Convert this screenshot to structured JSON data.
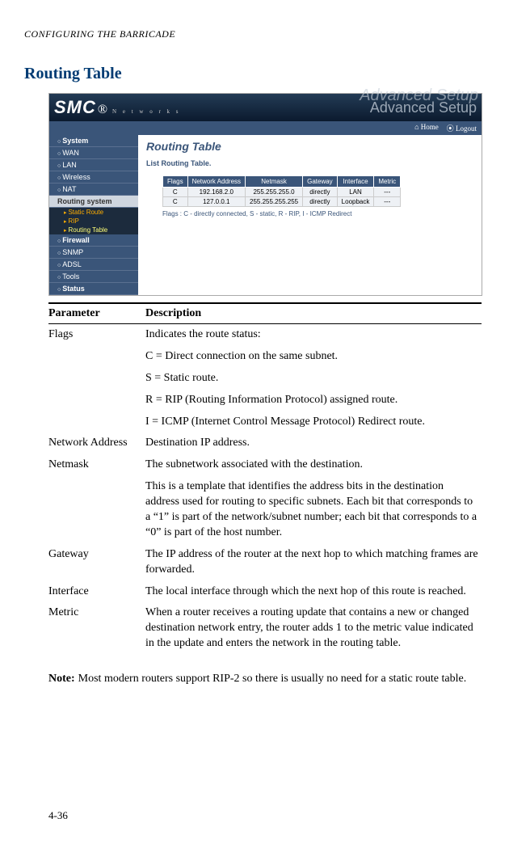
{
  "header": {
    "running": "CONFIGURING THE BARRICADE"
  },
  "section": {
    "title": "Routing Table"
  },
  "router_ui": {
    "logo": {
      "brand": "SMC",
      "reg": "®",
      "subtitle": "N e t w o r k s"
    },
    "titlebar": {
      "ghost": "Advanced Setup",
      "main": "Advanced Setup"
    },
    "toplinks": {
      "home": "Home",
      "logout": "Logout"
    },
    "sidebar": {
      "items": [
        {
          "label": "System"
        },
        {
          "label": "WAN"
        },
        {
          "label": "LAN"
        },
        {
          "label": "Wireless"
        },
        {
          "label": "NAT"
        }
      ],
      "selected": "Routing system",
      "subs": [
        {
          "label": "Static Route"
        },
        {
          "label": "RIP"
        },
        {
          "label": "Routing Table"
        }
      ],
      "items2": [
        {
          "label": "Firewall"
        },
        {
          "label": "SNMP"
        },
        {
          "label": "ADSL"
        },
        {
          "label": "Tools"
        },
        {
          "label": "Status"
        }
      ]
    },
    "content": {
      "title": "Routing Table",
      "subtitle": "List Routing Table.",
      "cols": [
        "Flags",
        "Network Address",
        "Netmask",
        "Gateway",
        "Interface",
        "Metric"
      ],
      "rows": [
        [
          "C",
          "192.168.2.0",
          "255.255.255.0",
          "directly",
          "LAN",
          "---"
        ],
        [
          "C",
          "127.0.0.1",
          "255.255.255.255",
          "directly",
          "Loopback",
          "---"
        ]
      ],
      "flags_note": "Flags :   C - directly connected, S - static, R - RIP, I - ICMP Redirect"
    }
  },
  "params": {
    "head": {
      "param": "Parameter",
      "desc": "Description"
    },
    "flags_label": "Flags",
    "flags_intro": "Indicates the route status:",
    "flag_c": "C = Direct connection on the same subnet.",
    "flag_s": "S = Static route.",
    "flag_r": "R = RIP (Routing Information Protocol) assigned route.",
    "flag_i": "I = ICMP (Internet Control Message Protocol) Redirect route.",
    "na_label": "Network Address",
    "na_desc": "Destination IP address.",
    "nm_label": "Netmask",
    "nm_desc1": "The subnetwork associated with the destination.",
    "nm_desc2": "This is a template that identifies the address bits in the destination address used for routing to specific subnets. Each bit that corresponds to a “1” is part of the network/subnet number; each bit that corresponds to a “0” is part of the host number.",
    "gw_label": "Gateway",
    "gw_desc": "The IP address of the router at the next hop to which matching frames are forwarded.",
    "if_label": "Interface",
    "if_desc": "The local interface through which the next hop of this route is reached.",
    "me_label": "Metric",
    "me_desc": "When a router receives a routing update that contains a new or changed destination network entry, the router adds 1 to the metric value indicated in the update and enters the network in the routing table."
  },
  "note": {
    "label": "Note:",
    "text": "Most modern routers support RIP-2 so there is usually no need for a static route table."
  },
  "page": {
    "number": "4-36"
  }
}
